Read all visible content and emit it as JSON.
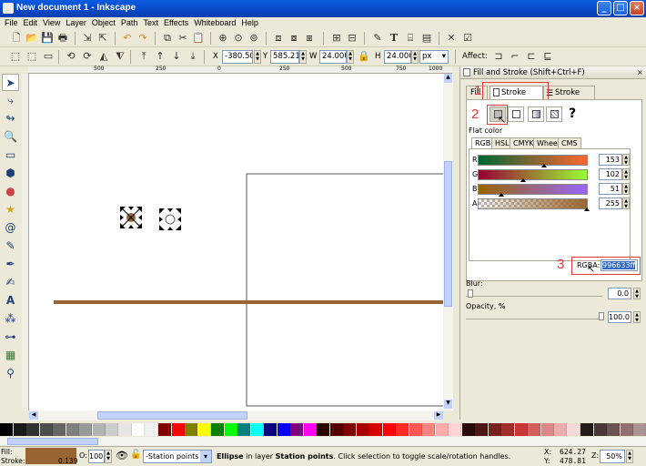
{
  "window": {
    "title": "New document 1 - Inkscape"
  },
  "menu": [
    "File",
    "Edit",
    "View",
    "Layer",
    "Object",
    "Path",
    "Text",
    "Effects",
    "Whiteboard",
    "Help"
  ],
  "controls": {
    "x_label": "X",
    "x_value": "-380.50",
    "y_label": "Y",
    "y_value": "585.214",
    "w_label": "W",
    "w_value": "24.000",
    "h_label": "H",
    "h_value": "24.000",
    "unit": "px",
    "affect_label": "Affect:"
  },
  "ruler": {
    "h_ticks": [
      "500",
      "250",
      "0",
      "250",
      "500",
      "750",
      "1000"
    ]
  },
  "panel": {
    "title": "Fill and Stroke (Shift+Ctrl+F)",
    "tabs": [
      "Fill",
      "Stroke paint",
      "Stroke style"
    ],
    "flat_color": "Flat color",
    "subtabs": [
      "RGB",
      "HSL",
      "CMYK",
      "Wheel",
      "CMS"
    ],
    "channels": [
      {
        "label": "R",
        "value": "153"
      },
      {
        "label": "G",
        "value": "102"
      },
      {
        "label": "B",
        "value": "51"
      },
      {
        "label": "A",
        "value": "255"
      }
    ],
    "rgba_label": "RGBA:",
    "rgba_value": "996633ff",
    "blur_label": "Blur:",
    "blur_value": "0.0",
    "opacity_label": "Opacity, %",
    "opacity_value": "100.0",
    "annotations": [
      "1",
      "2",
      "3"
    ]
  },
  "status": {
    "fill_label": "Fill:",
    "stroke_label": "Stroke:",
    "stroke_width": "0.139",
    "opacity_label": "O:",
    "opacity_value": "100",
    "layer": "-Station points",
    "message_bold": "Ellipse",
    "message_mid": " in layer ",
    "message_layer": "Station points",
    "message_rest": ". Click selection to toggle scale/rotation handles.",
    "cursor_x_label": "X:",
    "cursor_x": "624.27",
    "cursor_y_label": "Y:",
    "cursor_y": "478.81",
    "zoom_label": "Z:",
    "zoom": "50%"
  },
  "colors": {
    "fill": "#996633",
    "accent_red": "#e53b3b",
    "titlebar": "#0a5ce0"
  }
}
